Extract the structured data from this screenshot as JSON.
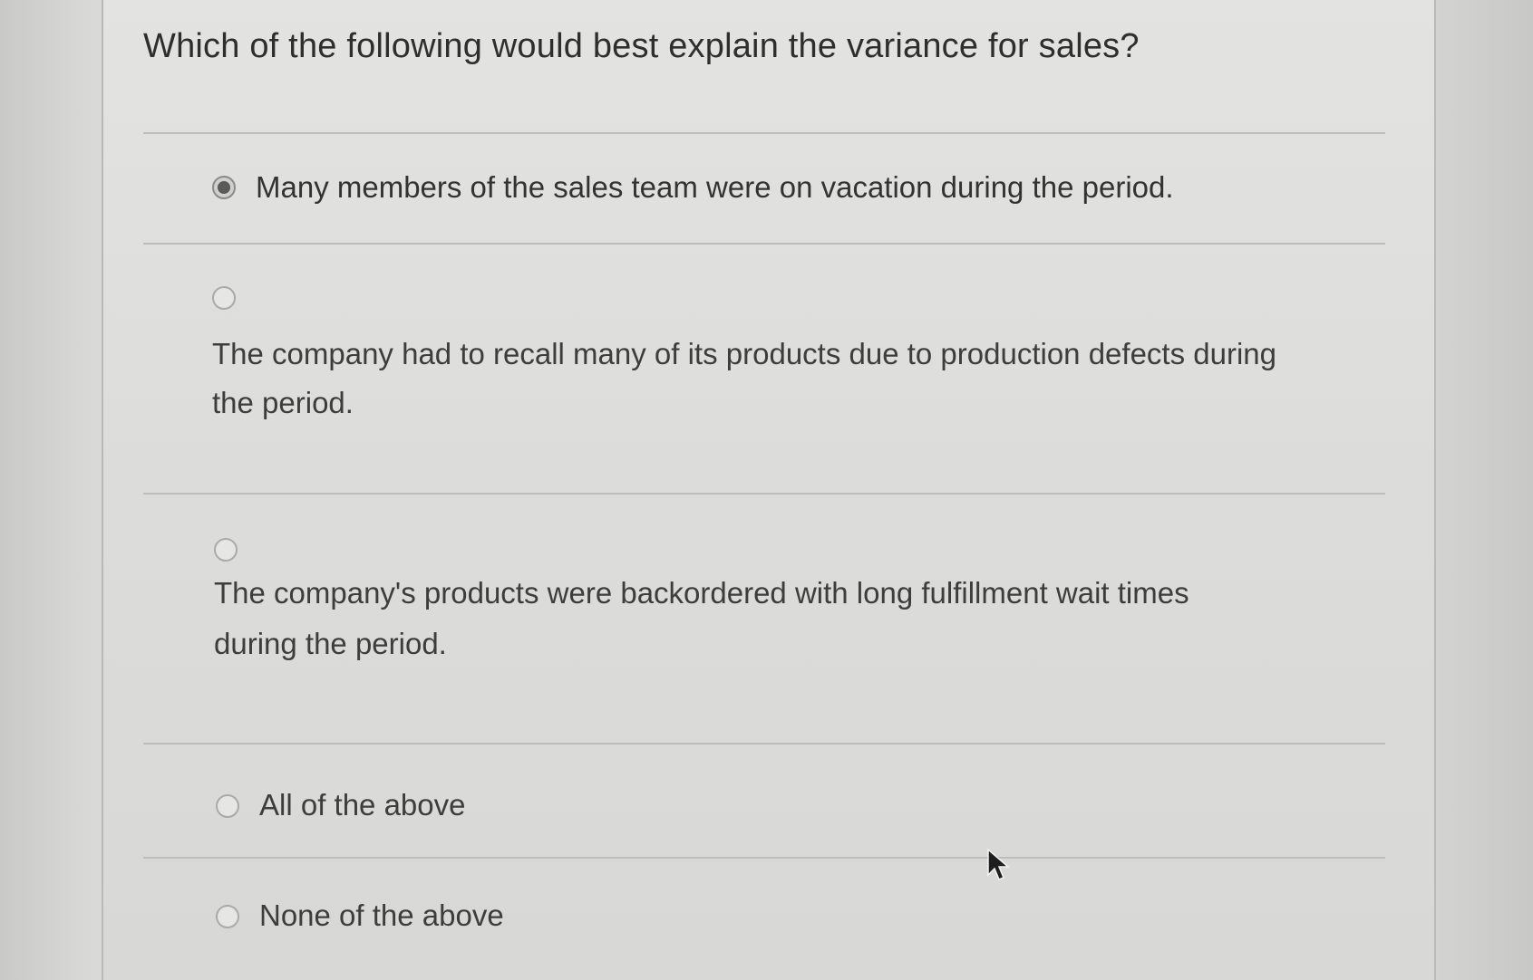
{
  "question": {
    "text": "Which of the following would best explain the variance for sales?"
  },
  "options": [
    {
      "label": "Many members of the sales team were on vacation during the period.",
      "selected": true
    },
    {
      "label_line1": "The company had to recall many of its products due to production defects during",
      "label_line2": "the period.",
      "selected": false
    },
    {
      "label_line1": "The company's products were backordered with long fulfillment wait times",
      "label_line2": "during the period.",
      "selected": false
    },
    {
      "label": "All of the above",
      "selected": false
    },
    {
      "label": "None of the above",
      "selected": false
    }
  ],
  "icons": {
    "radio_selected": "radio-selected-icon",
    "radio_unselected": "radio-unselected-icon",
    "cursor": "mouse-pointer-icon"
  }
}
